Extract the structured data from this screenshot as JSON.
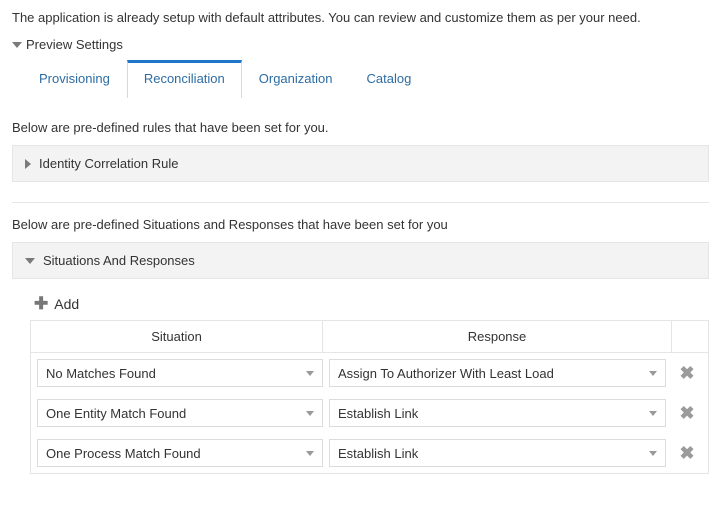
{
  "intro": "The application is already setup with default attributes. You can review and customize them as per your need.",
  "preview_settings_label": "Preview Settings",
  "tabs": {
    "provisioning": "Provisioning",
    "reconciliation": "Reconciliation",
    "organization": "Organization",
    "catalog": "Catalog"
  },
  "rules_desc": "Below are pre-defined rules that have been set for you.",
  "identity_rule_label": "Identity Correlation Rule",
  "situations_desc": "Below are pre-defined Situations and Responses that have been set for you",
  "situations_panel_label": "Situations And Responses",
  "add_label": "Add",
  "table": {
    "headers": {
      "situation": "Situation",
      "response": "Response"
    },
    "rows": [
      {
        "situation": "No Matches Found",
        "response": "Assign To Authorizer With Least Load"
      },
      {
        "situation": "One Entity Match Found",
        "response": "Establish Link"
      },
      {
        "situation": "One Process Match Found",
        "response": "Establish Link"
      }
    ]
  }
}
